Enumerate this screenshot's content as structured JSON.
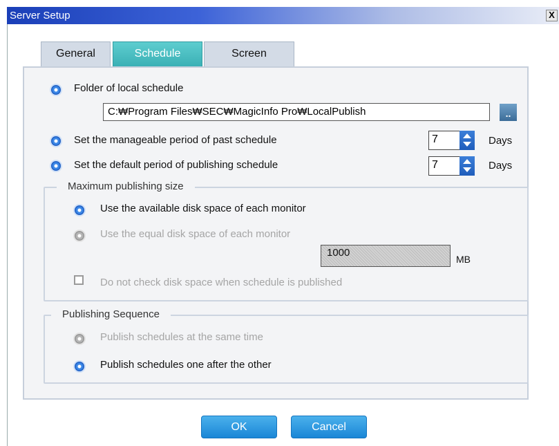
{
  "window": {
    "title": "Server Setup",
    "close_label": "X"
  },
  "tabs": [
    {
      "label": "General",
      "active": false
    },
    {
      "label": "Schedule",
      "active": true
    },
    {
      "label": "Screen",
      "active": false
    }
  ],
  "schedule": {
    "folder_label": "Folder of local schedule",
    "folder_path": "C:₩Program Files₩SEC₩MagicInfo Pro₩LocalPublish",
    "browse_label": "..",
    "past_period": {
      "label": "Set the manageable period of past schedule",
      "value": "7",
      "unit": "Days"
    },
    "publish_period": {
      "label": "Set the default period of publishing schedule",
      "value": "7",
      "unit": "Days"
    }
  },
  "max_size": {
    "legend": "Maximum publishing size",
    "option_available": "Use the available disk space of each monitor",
    "option_equal": "Use the equal disk space of each monitor",
    "size_value": "1000",
    "size_unit": "MB",
    "no_check_label": "Do not check disk space when schedule is published",
    "no_check_checked": false
  },
  "sequence": {
    "legend": "Publishing Sequence",
    "option_same_time": "Publish schedules at the same time",
    "option_one_after": "Publish schedules one after the other"
  },
  "buttons": {
    "ok": "OK",
    "cancel": "Cancel"
  },
  "colors": {
    "title_bar": "#1a3fb8",
    "tab_active": "#3ab0b5",
    "button": "#1a86d6",
    "accent": "#1f5fc4"
  }
}
